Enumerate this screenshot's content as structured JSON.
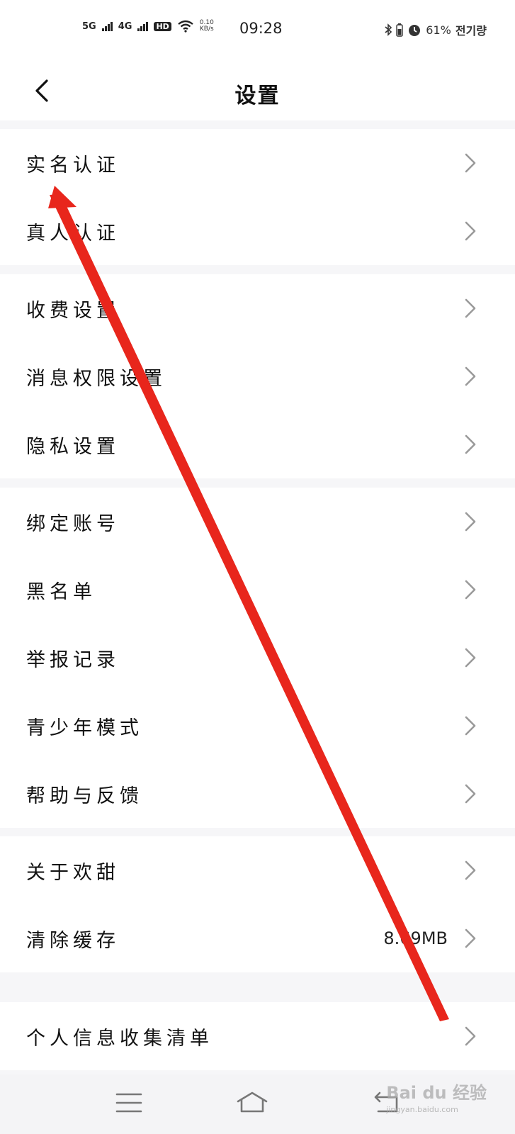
{
  "status_bar": {
    "net1": "5G",
    "net2": "4G",
    "hd": "HD",
    "speed_value": "0.10",
    "speed_unit": "KB/s",
    "time": "09:28",
    "battery": "61%",
    "carrier_suffix": "전기량"
  },
  "header": {
    "title": "设置"
  },
  "groups": [
    {
      "items": [
        {
          "label": "实名认证"
        },
        {
          "label": "真人认证"
        }
      ]
    },
    {
      "items": [
        {
          "label": "收费设置"
        },
        {
          "label": "消息权限设置"
        },
        {
          "label": "隐私设置"
        }
      ]
    },
    {
      "items": [
        {
          "label": "绑定账号"
        },
        {
          "label": "黑名单"
        },
        {
          "label": "举报记录"
        },
        {
          "label": "青少年模式"
        },
        {
          "label": "帮助与反馈"
        }
      ]
    },
    {
      "items": [
        {
          "label": "关于欢甜"
        },
        {
          "label": "清除缓存",
          "value": "8.69MB"
        }
      ]
    },
    {
      "items": [
        {
          "label": "个人信息收集清单"
        }
      ]
    }
  ],
  "watermark": {
    "brand": "Bai du 经验",
    "url": "jingyan.baidu.com"
  },
  "annotation_color": "#e8261c",
  "icons": [
    "back-icon",
    "chevron-right-icon",
    "menu-icon",
    "home-icon",
    "return-icon",
    "wifi-icon",
    "bluetooth-icon",
    "alarm-icon",
    "battery-icon"
  ]
}
